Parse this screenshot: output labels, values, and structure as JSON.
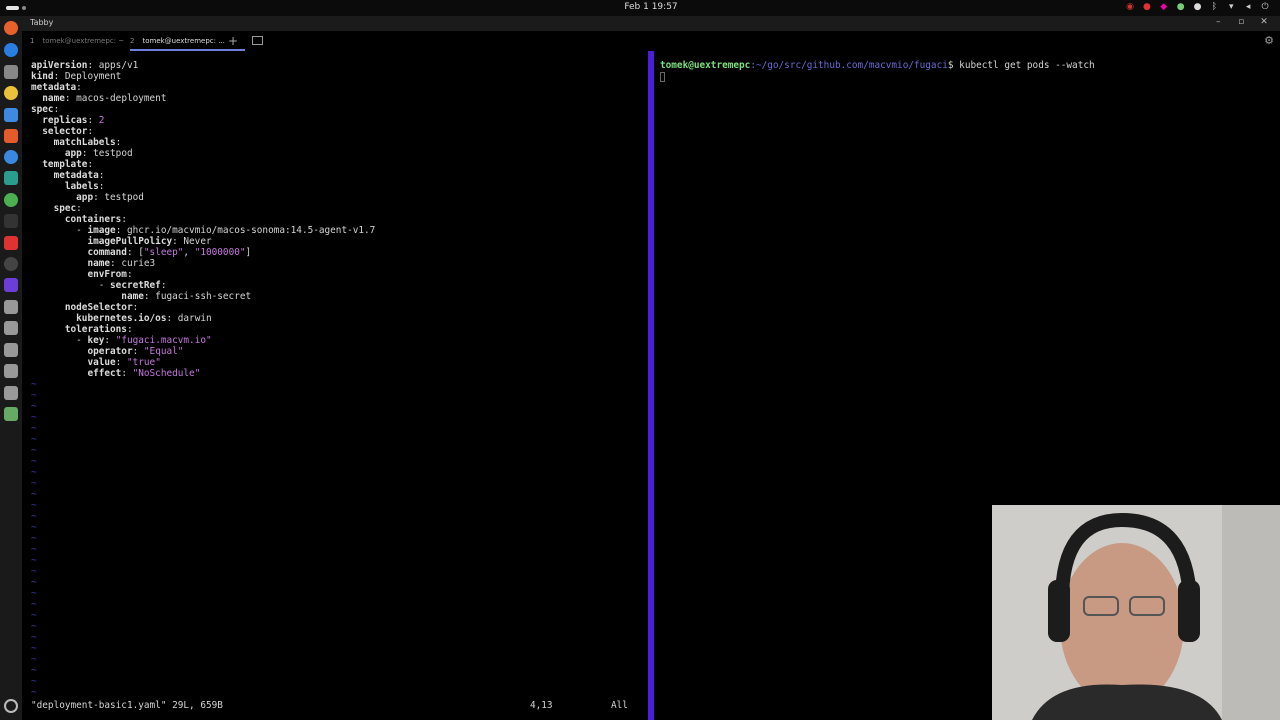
{
  "system": {
    "clock": "Feb 1  19:57"
  },
  "window": {
    "title": "Tabby"
  },
  "tabs": [
    {
      "num": "1",
      "label": "tomek@uextremepc: ~"
    },
    {
      "num": "2",
      "label": "tomek@uextremepc: ..."
    }
  ],
  "editor": {
    "lines": [
      [
        {
          "t": "apiVersion",
          "c": "k"
        },
        {
          "t": ": apps/v1"
        }
      ],
      [
        {
          "t": "kind",
          "c": "k"
        },
        {
          "t": ": Deployment"
        }
      ],
      [
        {
          "t": "metadata",
          "c": "k"
        },
        {
          "t": ":"
        }
      ],
      [
        {
          "t": "  name",
          "c": "k"
        },
        {
          "t": ": macos-deployment"
        }
      ],
      [
        {
          "t": "spec",
          "c": "k"
        },
        {
          "t": ":"
        }
      ],
      [
        {
          "t": "  replicas",
          "c": "k"
        },
        {
          "t": ": "
        },
        {
          "t": "2",
          "c": "s"
        }
      ],
      [
        {
          "t": "  selector",
          "c": "k"
        },
        {
          "t": ":"
        }
      ],
      [
        {
          "t": "    matchLabels",
          "c": "k"
        },
        {
          "t": ":"
        }
      ],
      [
        {
          "t": "      app",
          "c": "k"
        },
        {
          "t": ": testpod"
        }
      ],
      [
        {
          "t": "  template",
          "c": "k"
        },
        {
          "t": ":"
        }
      ],
      [
        {
          "t": "    metadata",
          "c": "k"
        },
        {
          "t": ":"
        }
      ],
      [
        {
          "t": "      labels",
          "c": "k"
        },
        {
          "t": ":"
        }
      ],
      [
        {
          "t": "        app",
          "c": "k"
        },
        {
          "t": ": testpod"
        }
      ],
      [
        {
          "t": "    spec",
          "c": "k"
        },
        {
          "t": ":"
        }
      ],
      [
        {
          "t": "      containers",
          "c": "k"
        },
        {
          "t": ":"
        }
      ],
      [
        {
          "t": "        - "
        },
        {
          "t": "image",
          "c": "k"
        },
        {
          "t": ": ghcr.io/macvmio/macos-sonoma:14.5-agent-v1.7"
        }
      ],
      [
        {
          "t": "          imagePullPolicy",
          "c": "k"
        },
        {
          "t": ": Never"
        }
      ],
      [
        {
          "t": "          command",
          "c": "k"
        },
        {
          "t": ": ["
        },
        {
          "t": "\"sleep\"",
          "c": "s"
        },
        {
          "t": ", "
        },
        {
          "t": "\"1000000\"",
          "c": "s"
        },
        {
          "t": "]"
        }
      ],
      [
        {
          "t": "          name",
          "c": "k"
        },
        {
          "t": ": curie3"
        }
      ],
      [
        {
          "t": "          envFrom",
          "c": "k"
        },
        {
          "t": ":"
        }
      ],
      [
        {
          "t": "            - "
        },
        {
          "t": "secretRef",
          "c": "k"
        },
        {
          "t": ":"
        }
      ],
      [
        {
          "t": "                name",
          "c": "k"
        },
        {
          "t": ": fugaci-ssh-secret"
        }
      ],
      [
        {
          "t": "      nodeSelector",
          "c": "k"
        },
        {
          "t": ":"
        }
      ],
      [
        {
          "t": "        kubernetes.io/os",
          "c": "k"
        },
        {
          "t": ": darwin"
        }
      ],
      [
        {
          "t": "      tolerations",
          "c": "k"
        },
        {
          "t": ":"
        }
      ],
      [
        {
          "t": "        - "
        },
        {
          "t": "key",
          "c": "k"
        },
        {
          "t": ": "
        },
        {
          "t": "\"fugaci.macvm.io\"",
          "c": "s"
        }
      ],
      [
        {
          "t": "          operator",
          "c": "k"
        },
        {
          "t": ": "
        },
        {
          "t": "\"Equal\"",
          "c": "s"
        }
      ],
      [
        {
          "t": "          value",
          "c": "k"
        },
        {
          "t": ": "
        },
        {
          "t": "\"true\"",
          "c": "s"
        }
      ],
      [
        {
          "t": "          effect",
          "c": "k"
        },
        {
          "t": ": "
        },
        {
          "t": "\"NoSchedule\"",
          "c": "s"
        }
      ]
    ],
    "tilde": "~",
    "status_file": "\"deployment-basic1.yaml\" 29L, 659B",
    "cursor_pos": "4,13",
    "scroll": "All"
  },
  "terminal": {
    "user_host": "tomek@uextremepc",
    "path": ":~/go/src/github.com/macvmio/fugaci",
    "prompt_end": "$ ",
    "command": "kubectl get pods --watch"
  },
  "colors": {
    "divider": "#4a1fd6",
    "keyword": "#dcdcdc",
    "string": "#c678dd",
    "prompt_user": "#7ee07e",
    "prompt_path": "#6b6bd6"
  }
}
